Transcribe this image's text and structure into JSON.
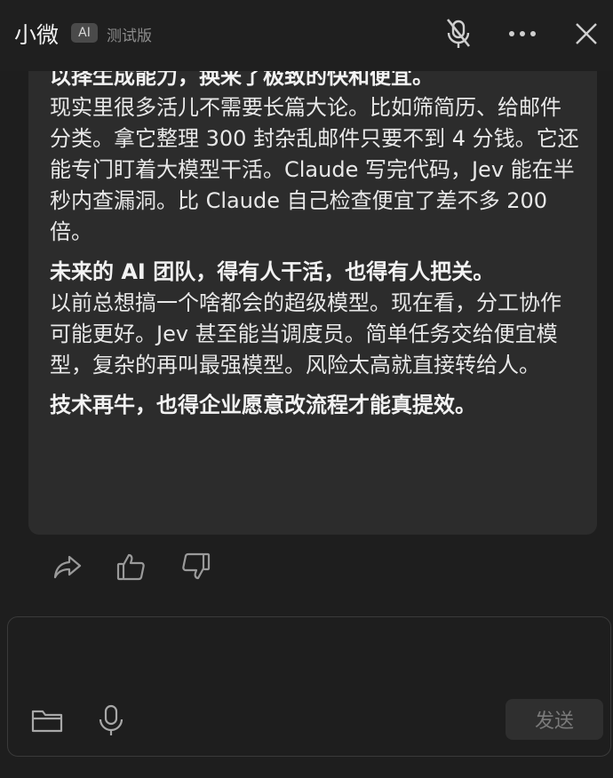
{
  "header": {
    "title": "小微",
    "badge": "AI",
    "beta": "测试版"
  },
  "message": {
    "cut_top_line": "以择生成能力，换来了极致的快和便宜。",
    "paragraphs": [
      {
        "lead": "",
        "text": "现实里很多活儿不需要长篇大论。比如筛简历、给邮件分类。拿它整理 300 封杂乱邮件只要不到 4 分钱。它还能专门盯着大模型干活。Claude 写完代码，Jev 能在半秒内查漏洞。比 Claude 自己检查便宜了差不多 200 倍。"
      },
      {
        "lead": "未来的 AI 团队，得有人干活，也得有人把关。",
        "text": "以前总想搞一个啥都会的超级模型。现在看，分工协作可能更好。Jev 甚至能当调度员。简单任务交给便宜模型，复杂的再叫最强模型。风险太高就直接转给人。"
      },
      {
        "lead": "技术再牛，也得企业愿意改流程才能真提效。",
        "text": ""
      }
    ]
  },
  "composer": {
    "placeholder": "",
    "send_label": "发送"
  },
  "icons": {
    "mute": "mic-off-icon",
    "more": "more-horizontal-icon",
    "close": "close-icon",
    "share": "share-icon",
    "like": "thumbs-up-icon",
    "dislike": "thumbs-down-icon",
    "attach": "folder-icon",
    "voice": "microphone-icon"
  },
  "colors": {
    "background": "#1e1e1e",
    "bubble": "#2c2c2c",
    "text": "#e8e8e8",
    "muted": "#8c8c8c"
  }
}
